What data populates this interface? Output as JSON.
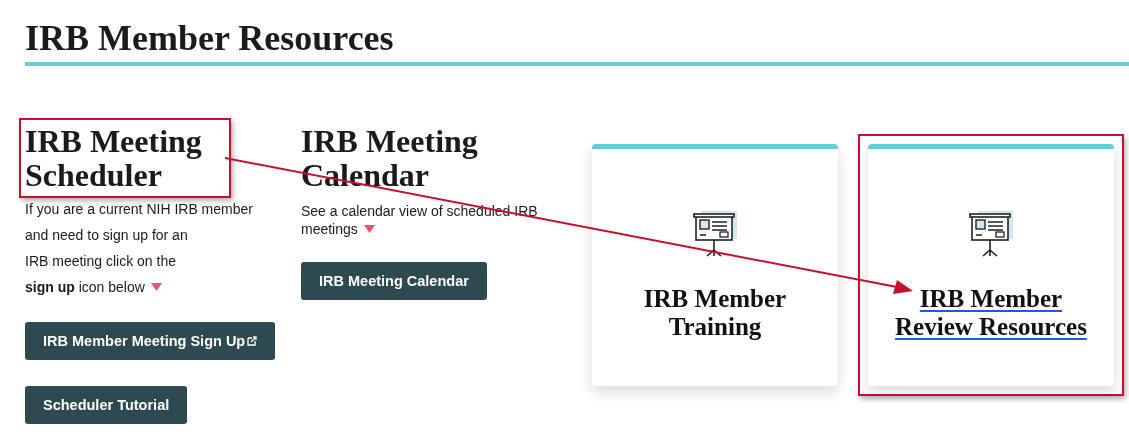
{
  "page_title": "IRB Member Resources",
  "sections": [
    {
      "title": "IRB Meeting Scheduler",
      "annotated": true,
      "description": [
        "If you are a current NIH IRB member",
        "and need to sign up for an",
        "IRB meeting click on the",
        "**sign up** icon below"
      ],
      "loose": true,
      "buttons": [
        {
          "label": "IRB Member Meeting Sign Up",
          "external": true
        },
        {
          "label": "Scheduler Tutorial",
          "external": false
        }
      ]
    },
    {
      "title": "IRB Meeting Calendar",
      "annotated": false,
      "description": [
        "See a calendar view of scheduled IRB",
        "meetings"
      ],
      "loose": false,
      "buttons": [
        {
          "label": "IRB Meeting Calendar",
          "external": false
        }
      ]
    }
  ],
  "cards": [
    {
      "title": "IRB Member Training",
      "link": false,
      "annotated": false
    },
    {
      "title": "IRB Member Review Resources",
      "link": true,
      "annotated": true
    }
  ]
}
